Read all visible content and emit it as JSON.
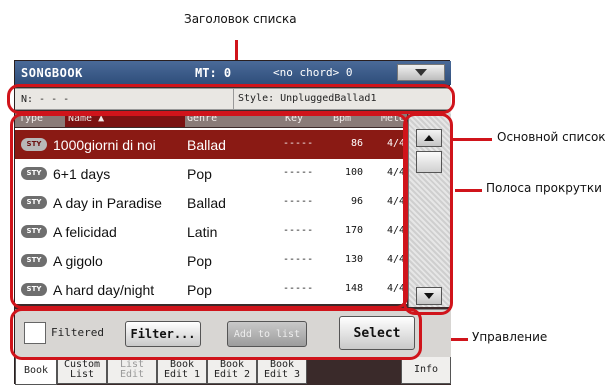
{
  "annotations": {
    "list_header": "Заголовок списка",
    "main_list": "Основной список",
    "scrollbar": "Полоса прокрутки",
    "controls": "Управление"
  },
  "titlebar": {
    "app": "SONGBOOK",
    "mt": "MT: 0",
    "chord": "<no chord> 0"
  },
  "info_row": {
    "n": "N: - - -",
    "style": "Style: UnpluggedBallad1"
  },
  "columns": {
    "type": "Type",
    "name": "Name ▲",
    "genre": "Genre",
    "key": "Key",
    "bpm": "Bpm",
    "meter": "Mete"
  },
  "rows": [
    {
      "badge": "STY",
      "name": "1000giorni di noi",
      "genre": "Ballad",
      "key": "-----",
      "bpm": "86",
      "meter": "4/4"
    },
    {
      "badge": "STY",
      "name": "6+1 days",
      "genre": "Pop",
      "key": "-----",
      "bpm": "100",
      "meter": "4/4"
    },
    {
      "badge": "STY",
      "name": "A day in Paradise",
      "genre": "Ballad",
      "key": "-----",
      "bpm": "96",
      "meter": "4/4"
    },
    {
      "badge": "STY",
      "name": "A felicidad",
      "genre": "Latin",
      "key": "-----",
      "bpm": "170",
      "meter": "4/4"
    },
    {
      "badge": "STY",
      "name": "A gigolo",
      "genre": "Pop",
      "key": "-----",
      "bpm": "130",
      "meter": "4/4"
    },
    {
      "badge": "STY",
      "name": "A hard day/night",
      "genre": "Pop",
      "key": "-----",
      "bpm": "148",
      "meter": "4/4"
    }
  ],
  "controls": {
    "filtered_label": "Filtered",
    "filter_button": "Filter...",
    "add_button": "Add to list",
    "select_button": "Select"
  },
  "tabs": [
    {
      "label": "Book"
    },
    {
      "label": "Custom\nList"
    },
    {
      "label": "List\nEdit"
    },
    {
      "label": "Book\nEdit 1"
    },
    {
      "label": "Book\nEdit 2"
    },
    {
      "label": "Book\nEdit 3"
    },
    {
      "label": "Info"
    }
  ],
  "colors": {
    "annotation_red": "#d0141b",
    "title_blue": "#2e4d7a",
    "selected_row": "#8a1a14"
  }
}
